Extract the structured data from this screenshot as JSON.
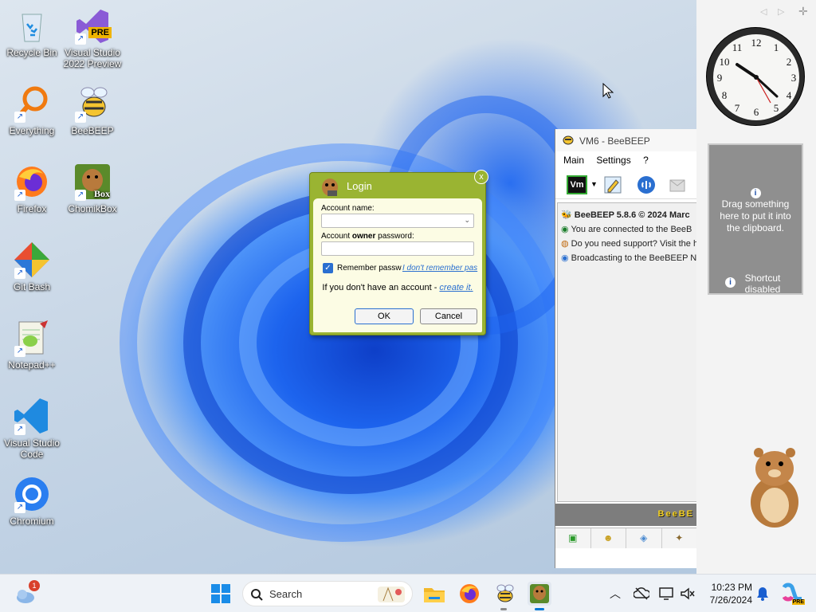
{
  "desktop": {
    "icons": [
      {
        "label": "Recycle Bin",
        "icon": "recycle-bin-icon",
        "shortcut": false
      },
      {
        "label": "Visual Studio 2022 Preview",
        "icon": "visual-studio-preview-icon",
        "badge": "PRE",
        "shortcut": true
      },
      {
        "label": "Everything",
        "icon": "everything-search-icon",
        "shortcut": true
      },
      {
        "label": "BeeBEEP",
        "icon": "beebeep-icon",
        "shortcut": true
      },
      {
        "label": "Firefox",
        "icon": "firefox-icon",
        "shortcut": true
      },
      {
        "label": "ChomikBox",
        "icon": "chomikbox-icon",
        "badge": "Box",
        "shortcut": true
      },
      {
        "label": "Git Bash",
        "icon": "git-bash-icon",
        "shortcut": true
      },
      {
        "label": "Notepad++",
        "icon": "notepad-plus-plus-icon",
        "shortcut": true
      },
      {
        "label": "Visual Studio Code",
        "icon": "vscode-icon",
        "shortcut": true
      },
      {
        "label": "Chromium",
        "icon": "chromium-icon",
        "shortcut": true
      }
    ]
  },
  "clock": {
    "numbers": [
      "12",
      "1",
      "2",
      "3",
      "4",
      "5",
      "6",
      "7",
      "8",
      "9",
      "10",
      "11"
    ]
  },
  "clipboard_gadget": {
    "drop_text": "Drag something here to put it into the clipboard.",
    "shortcut_text": "Shortcut disabled",
    "info_glyph": "i"
  },
  "beebeep": {
    "title": "VM6 - BeeBEEP",
    "menu": [
      "Main",
      "Settings",
      "?"
    ],
    "status_label": "Vm",
    "messages": [
      "BeeBEEP 5.8.6 © 2024 Marc",
      "You are connected to the BeeB",
      "Do you need support? Visit the h",
      "Broadcasting to the BeeBEEP Ne"
    ],
    "footer_brand": "BeeBE"
  },
  "login": {
    "title": "Login",
    "account_name_label": "Account name:",
    "password_label_prefix": "Account ",
    "password_label_bold": "owner",
    "password_label_suffix": " password:",
    "account_name_value": "",
    "password_value": "",
    "remember_label": "Remember passw",
    "remember_checked": true,
    "forgot_link": "I don't remember pas",
    "no_account_text": "If you don't have an account - ",
    "create_link": "create it.",
    "ok_label": "OK",
    "cancel_label": "Cancel",
    "close_glyph": "x"
  },
  "taskbar": {
    "weather_badge": "1",
    "search_placeholder": "Search",
    "time": "10:23 PM",
    "date": "7/26/2024",
    "copilot_badge": "PRE",
    "accent": "#0078d4"
  }
}
